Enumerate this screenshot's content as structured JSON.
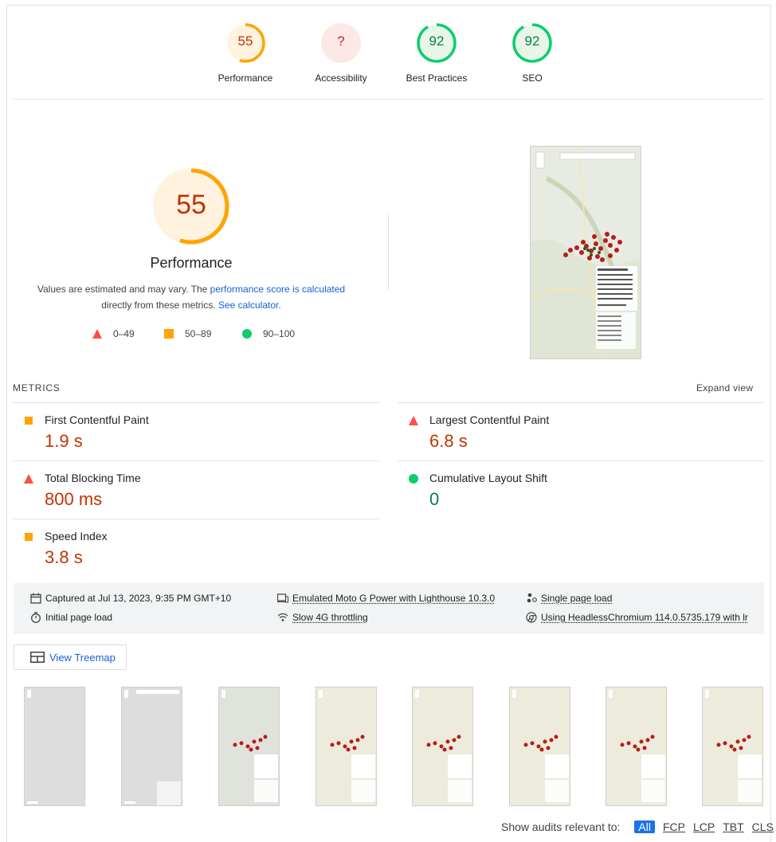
{
  "gauges": [
    {
      "score": "55",
      "label": "Performance",
      "ring": "#ffa400",
      "bg": "#fff3e0",
      "text": "#c33300",
      "fraction": 0.55
    },
    {
      "score": "?",
      "label": "Accessibility",
      "ring": "#ffcdd2",
      "bg": "#fde8e8",
      "text": "#c62828",
      "fraction": 0
    },
    {
      "score": "92",
      "label": "Best Practices",
      "ring": "#0cce6b",
      "bg": "#e8f5e9",
      "text": "#018642",
      "fraction": 0.92
    },
    {
      "score": "92",
      "label": "SEO",
      "ring": "#0cce6b",
      "bg": "#e8f5e9",
      "text": "#018642",
      "fraction": 0.92
    }
  ],
  "performance": {
    "score": "55",
    "fraction": 0.55,
    "title": "Performance",
    "desc_pre": "Values are estimated and may vary. The ",
    "desc_link": "performance score is calculated",
    "desc_mid": "directly from these metrics. ",
    "desc_link2": "See calculator.",
    "legend": [
      "0–49",
      "50–89",
      "90–100"
    ]
  },
  "metrics": {
    "heading": "METRICS",
    "expand": "Expand view",
    "items": [
      {
        "name": "First Contentful Paint",
        "value": "1.9 s",
        "status": "average"
      },
      {
        "name": "Largest Contentful Paint",
        "value": "6.8 s",
        "status": "fail"
      },
      {
        "name": "Total Blocking Time",
        "value": "800 ms",
        "status": "fail"
      },
      {
        "name": "Cumulative Layout Shift",
        "value": "0",
        "status": "pass"
      },
      {
        "name": "Speed Index",
        "value": "3.8 s",
        "status": "average"
      }
    ]
  },
  "runtime": {
    "captured": "Captured at Jul 13, 2023, 9:35 PM GMT+10",
    "initial": "Initial page load",
    "device": "Emulated Moto G Power with Lighthouse 10.3.0",
    "throttle": "Slow 4G throttling",
    "single": "Single page load",
    "browser": "Using HeadlessChromium 114.0.5735.179 with lr"
  },
  "treemap_label": "View Treemap",
  "audits": {
    "label": "Show audits relevant to:",
    "filters": [
      "All",
      "FCP",
      "LCP",
      "TBT",
      "CLS"
    ]
  },
  "colors": {
    "fail": "#ff4e42",
    "average": "#ffa400",
    "pass": "#0cce6b",
    "link": "#1a5fd6"
  }
}
